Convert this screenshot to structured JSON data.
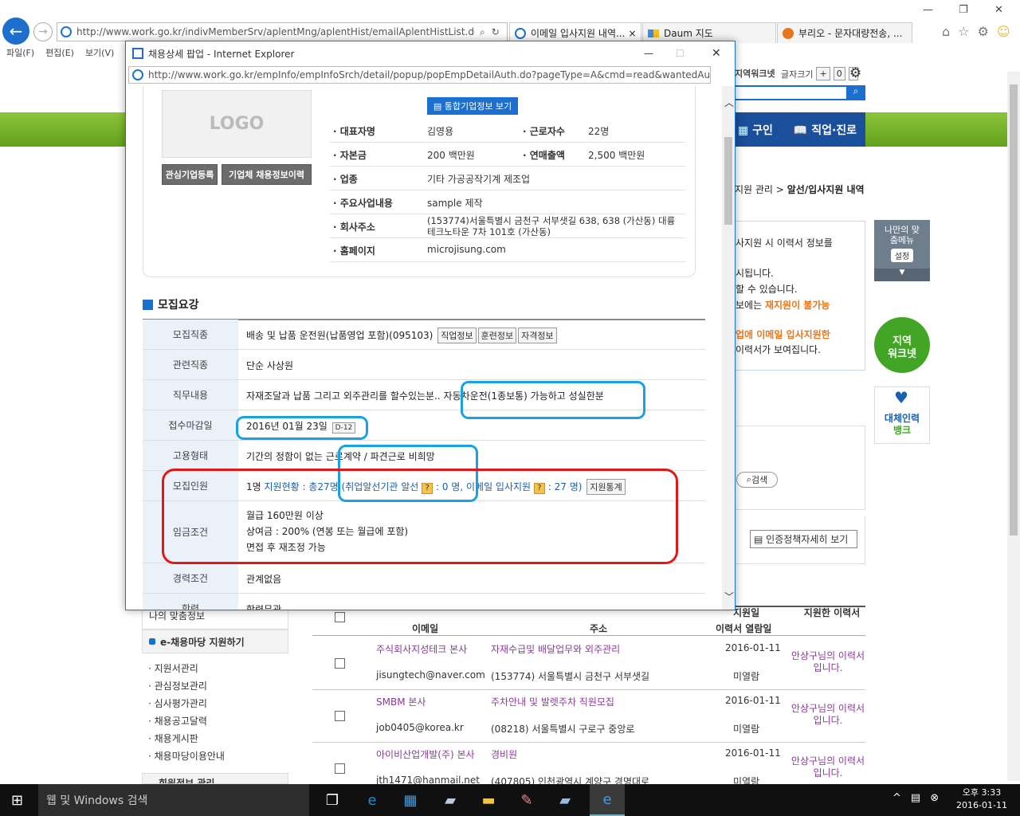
{
  "browser": {
    "address": "http://www.work.go.kr/indivMemberSrv/aplentMng/aplentHist/emailAplentHistList.do?this",
    "tabs": [
      "이메일 입사지원 내역...",
      "Daum 지도",
      "부리오 - 문자대량전송, ..."
    ],
    "menu": [
      "파일(F)",
      "편집(E)",
      "보기(V)"
    ]
  },
  "bg": {
    "worknet_label": "지역워크넷",
    "fontsize_label": "글자크기",
    "nav": [
      "구인",
      "직업·진로"
    ],
    "breadcrumb": "지원 관리 >",
    "breadcrumb_current": "알선/입사지원 내역",
    "info_lines": [
      "사지원 시 이력서 정보를",
      "시됩니다.",
      "할 수 있습니다.",
      "보에는",
      "재지원이 불가능",
      "업에 이메일 입사지원한",
      "이력서가 보여집니다."
    ],
    "mymenu": "나만의 맞춤메뉴",
    "mymenu_set": "설정",
    "worknet_btn": "지역 워크넷",
    "bank_btn1": "대체인력",
    "bank_btn2": "뱅크",
    "search_btn": "검색",
    "policy_btn": "인증정책자세히 보기",
    "sidebar_top": "나의 맞춤정보",
    "sidebar_title": "e-채용마당 지원하기",
    "sidebar_items": [
      "지원서관리",
      "관심정보관리",
      "심사평가관리",
      "채용공고달력",
      "채용게시판",
      "채용마당이용안내"
    ],
    "sidebar_bottom": "회원정보 관리",
    "table_headers": {
      "email": "이메일",
      "address": "주소",
      "applied": "지원일",
      "resume_view": "이력서 열람일",
      "resume": "지원한 이력서"
    },
    "rows": [
      {
        "company": "주식회사지성테크 본사",
        "email": "jisungtech@naver.com",
        "title": "자재수급및 배달업무와 외주관리",
        "address": "(153774) 서울특별시 금천구 서부샛길",
        "date": "2016-01-11",
        "view": "미열람",
        "resume": "안상구님의 이력서 입니다."
      },
      {
        "company": "SMBM 본사",
        "email": "job0405@korea.kr",
        "title": "주차안내 및 발렛주차 직원모집",
        "address": "(08218) 서울특별시 구로구 중앙로",
        "date": "2016-01-11",
        "view": "미열람",
        "resume": "안상구님의 이력서 입니다."
      },
      {
        "company": "아이비산업개발(주) 본사",
        "email": "jth1471@hanmail.net",
        "title": "경비원",
        "address": "(407805) 인천광역시 계양구 경명대로",
        "date": "2016-01-11",
        "view": "미열람",
        "resume": "안상구님의 이력서 입니다."
      }
    ]
  },
  "popup": {
    "title": "채용상세 팝업 - Internet Explorer",
    "address": "http://www.work.go.kr/empInfo/empInfoSrch/detail/popup/popEmpDetailAuth.do?pageType=A&cmd=read&wantedAuthNo=K120611",
    "logo": "LOGO",
    "btn_corp": "통합기업정보 보기",
    "btn_fav": "관심기업등록",
    "btn_hire": "기업체 채용정보이력",
    "company": {
      "ceo_label": "· 대표자명",
      "ceo": "김영용",
      "emp_label": "· 근로자수",
      "emp": "22명",
      "capital_label": "· 자본금",
      "capital": "200 백만원",
      "sales_label": "· 연매출액",
      "sales": "2,500 백만원",
      "industry_label": "· 업종",
      "industry": "기타 가공공작기계 제조업",
      "business_label": "· 주요사업내용",
      "business": "sample 제작",
      "address_label": "· 회사주소",
      "address1": "(153774)서울특별시 금천구 서부샛길 638, 638 (가산동) 대륭",
      "address2": "테크노타운 7차 101호 (가산동)",
      "homepage_label": "· 홈페이지",
      "homepage": "microjisung.com"
    },
    "section": "모집요강",
    "rows": {
      "job_label": "모집직종",
      "job": "배송 및 납품 운전원(납품영업 포함)(095103)",
      "job_btns": [
        "직업정보",
        "훈련정보",
        "자격정보"
      ],
      "related_label": "관련직종",
      "related": "단순 사상원",
      "duty_label": "직무내용",
      "duty1": "자재조달과 납품 그리고 외주관리를 할수있는분..",
      "duty2": "자동차운전(1종보통) 가능하고 성실한분",
      "deadline_label": "접수마감일",
      "deadline": "2016년 01월 23일",
      "dday": "D-12",
      "type_label": "고용형태",
      "type": "기간의 정함이 없는 근로계약 / 파견근로 비희망",
      "count_label": "모집인원",
      "count": "1명",
      "status": "지원현황 : 총27명 (취업알선기관 알선",
      "agency_count": ": 0 명,",
      "email_apply": "이메일 입사지원",
      "email_count": ": 27 명)",
      "stat_btn": "지원통계",
      "wage_label": "임금조건",
      "wage1": "월급 160만원 이상",
      "wage2": "상여금 : 200% (연봉 또는 월급에 포함)",
      "wage3": "면접 후 재조정 가능",
      "career_label": "경력조건",
      "career": "관계없음",
      "edu_label": "학력",
      "edu": "학력무관"
    }
  },
  "taskbar": {
    "search": "웹 및 Windows 검색",
    "time": "오후 3:33",
    "date": "2016-01-11"
  }
}
